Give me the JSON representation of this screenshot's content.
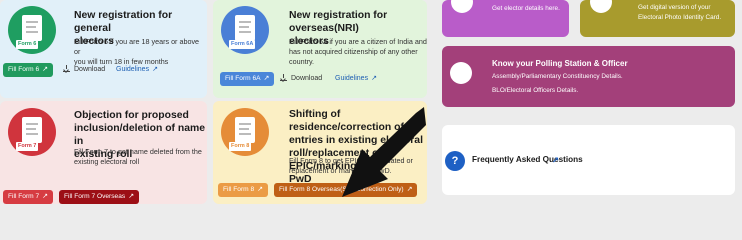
{
  "cards": [
    {
      "title_line1": "New registration for general",
      "title_line2": "electors",
      "desc_line1": "Fill Form 6 if you are 18 years or above or",
      "desc_line2": "you will turn 18 in few months",
      "form_label": "Form 6",
      "fill_btn": "Fill Form 6",
      "download": "Download",
      "guidelines": "Guidelines"
    },
    {
      "title_line1": "New registration for overseas(NRI)",
      "title_line2": "electors",
      "desc_line1": "Fill Form 6A if you are a citizen of India and",
      "desc_line2": "has not acquired citizenship of any other",
      "desc_line3": "country.",
      "form_label": "Form 6A",
      "fill_btn": "Fill Form 6A",
      "download": "Download",
      "guidelines": "Guidelines"
    },
    {
      "title_line1": "Objection for proposed",
      "title_line2": "inclusion/deletion of name in",
      "title_line3": "existing roll",
      "desc_line1": "Fill Form 7 to get name deleted from the",
      "desc_line2": "existing electoral roll",
      "form_label": "Form 7",
      "fill_btn": "Fill Form 7",
      "fill_btn2": "Fill Form 7 Overseas"
    },
    {
      "title_line1": "Shifting of residence/correction of",
      "title_line2": "entries in existing electoral",
      "title_line3": "roll/replacement of EPIC/marking of",
      "title_line4": "PwD",
      "desc_line1": "Fill Form 8 to get EPIC with updated or",
      "desc_line2": "replacement or marking of PwD.",
      "form_label": "Form 8",
      "fill_btn": "Fill Form 8",
      "fill_btn2": "Fill Form 8 Overseas(Self Correction Only)"
    }
  ],
  "right": {
    "tile1_text": "Get elector details here.",
    "tile2_line1": "Get digital version of your",
    "tile2_line2": "Electoral Photo Identity Card.",
    "tile3_title": "Know your Polling Station & Officer",
    "tile3_line1": "Assembly/Parliamentary Constituency Details.",
    "tile3_line2": "BLO/Electoral Officers Details.",
    "faq_icon": "?",
    "faq_label": "Frequently Asked Questions",
    "faq_arrow": "↗"
  },
  "colors": {
    "form6": "#1f9e61",
    "form6a": "#4a7fd6",
    "form7": "#d0343d",
    "form8": "#e58c38",
    "btn_green": "#219a5e",
    "btn_blue": "#4a86d9",
    "btn_red": "#d63c42",
    "btn_darkred": "#9c0f16",
    "btn_orange": "#eb9b45",
    "btn_darkorange": "#bf5f16"
  },
  "icons": [
    "form-document-icon",
    "download-icon",
    "external-link-icon",
    "search-person-icon",
    "id-card-icon",
    "location-pin-icon",
    "question-icon",
    "cursor-arrow-icon"
  ]
}
